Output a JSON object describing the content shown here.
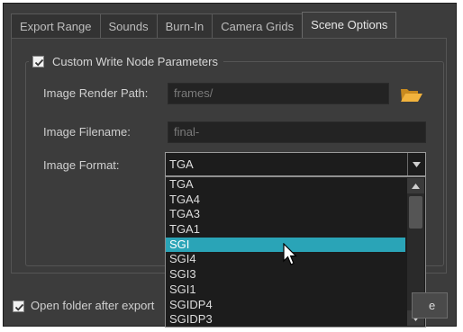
{
  "tabs": [
    {
      "label": "Export Range"
    },
    {
      "label": "Sounds"
    },
    {
      "label": "Burn-In"
    },
    {
      "label": "Camera Grids"
    },
    {
      "label": "Scene Options",
      "active": true
    }
  ],
  "group": {
    "title": "Custom Write Node Parameters",
    "checked": true
  },
  "fields": {
    "render_path_label": "Image Render Path:",
    "render_path_value": "frames/",
    "filename_label": "Image Filename:",
    "filename_value": "final-",
    "format_label": "Image Format:",
    "format_value": "TGA"
  },
  "dropdown": {
    "options": [
      "TGA",
      "TGA4",
      "TGA3",
      "TGA1",
      "SGI",
      "SGI4",
      "SGI3",
      "SGI1",
      "SGIDP4",
      "SGIDP3"
    ],
    "selected": "SGI"
  },
  "footer": {
    "open_folder_label": "Open folder after export",
    "open_folder_checked": true,
    "button_label": "e"
  },
  "colors": {
    "background": "#3c3c3c",
    "highlight": "#2aa4b7",
    "folder_icon": "#f2b33d"
  }
}
